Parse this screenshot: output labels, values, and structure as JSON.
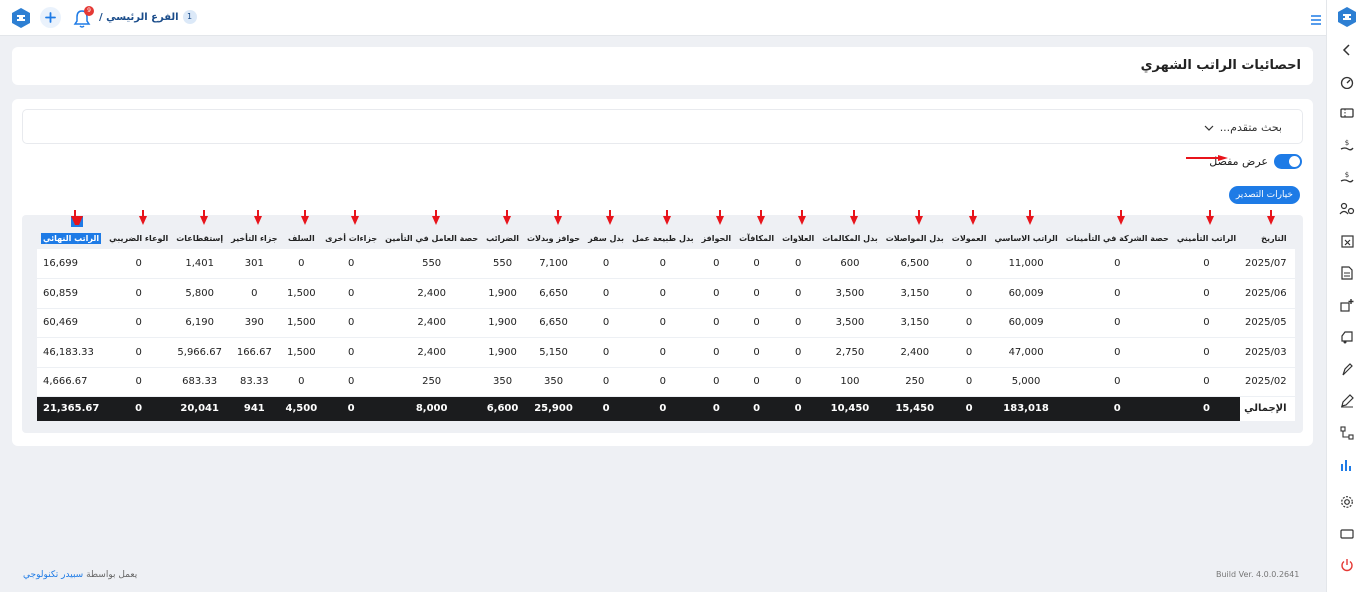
{
  "topbar": {
    "branch_number": "1",
    "branch_label": "الفرع الرئيسي /",
    "notification_count": "9"
  },
  "page": {
    "title": "احصائيات الراتب الشهري"
  },
  "filters": {
    "advanced_search_label": "بحث متقدم...",
    "detailed_view_label": "عرض مفصل",
    "export_label": "خيارات التصدير"
  },
  "table": {
    "headers": [
      "التاريخ",
      "الراتب التأميني",
      "حصة الشركة في التأمينات",
      "الراتب الاساسي",
      "العمولات",
      "بدل المواصلات",
      "بدل المكالمات",
      "العلاوات",
      "المكافآت",
      "الحوافز",
      "بدل طبيعة عمل",
      "بدل سفر",
      "حوافز وبدلات",
      "الضرائب",
      "حصة العامل في التأمين",
      "جزاءات أخرى",
      "السلف",
      "جزاء التأخير",
      "إستقطاعات",
      "الوعاء الضريبي",
      "الراتب النهائي"
    ],
    "rows": [
      [
        "2025/07",
        "0",
        "0",
        "11,000",
        "0",
        "6,500",
        "600",
        "0",
        "0",
        "0",
        "0",
        "0",
        "7,100",
        "550",
        "550",
        "0",
        "0",
        "301",
        "1,401",
        "0",
        "16,699"
      ],
      [
        "2025/06",
        "0",
        "0",
        "60,009",
        "0",
        "3,150",
        "3,500",
        "0",
        "0",
        "0",
        "0",
        "0",
        "6,650",
        "1,900",
        "2,400",
        "0",
        "1,500",
        "0",
        "5,800",
        "0",
        "60,859"
      ],
      [
        "2025/05",
        "0",
        "0",
        "60,009",
        "0",
        "3,150",
        "3,500",
        "0",
        "0",
        "0",
        "0",
        "0",
        "6,650",
        "1,900",
        "2,400",
        "0",
        "1,500",
        "390",
        "6,190",
        "0",
        "60,469"
      ],
      [
        "2025/03",
        "0",
        "0",
        "47,000",
        "0",
        "2,400",
        "2,750",
        "0",
        "0",
        "0",
        "0",
        "0",
        "5,150",
        "1,900",
        "2,400",
        "0",
        "1,500",
        "166.67",
        "5,966.67",
        "0",
        "46,183.33"
      ],
      [
        "2025/02",
        "0",
        "0",
        "5,000",
        "0",
        "250",
        "100",
        "0",
        "0",
        "0",
        "0",
        "0",
        "350",
        "350",
        "250",
        "0",
        "0",
        "83.33",
        "683.33",
        "0",
        "4,666.67"
      ]
    ],
    "total_row": [
      "الإجمالي",
      "0",
      "0",
      "183,018",
      "0",
      "15,450",
      "10,450",
      "0",
      "0",
      "0",
      "0",
      "0",
      "25,900",
      "6,600",
      "8,000",
      "0",
      "4,500",
      "941",
      "20,041",
      "0",
      "21,365.67"
    ]
  },
  "footer": {
    "powered_by": "يعمل بواسطة",
    "brand": "سبيدر تكنولوجي",
    "build": "Build Ver. 4.0.0.2641"
  },
  "colors": {
    "accent": "#1e7be6",
    "annotation": "#e8141b",
    "total_bg": "#1b1c1e"
  }
}
